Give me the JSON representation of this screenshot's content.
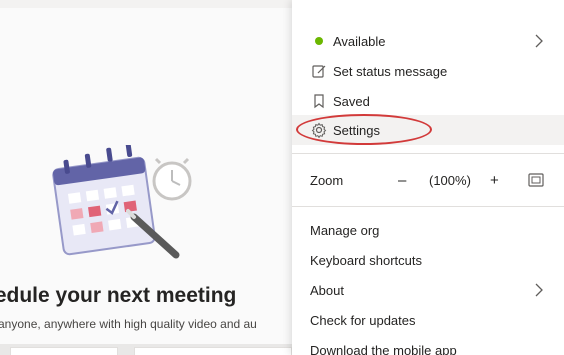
{
  "background": {
    "headline": "hedule your next meeting",
    "subline": "anyone, anywhere with high quality video and au"
  },
  "menu": {
    "status": {
      "label": "Available",
      "icon": "presence-dot-icon",
      "color": "#6bb700"
    },
    "items": [
      {
        "label": "Set status message",
        "icon": "edit-status-icon"
      },
      {
        "label": "Saved",
        "icon": "bookmark-icon"
      },
      {
        "label": "Settings",
        "icon": "gear-icon"
      }
    ],
    "zoom": {
      "label": "Zoom",
      "minus": "–",
      "value": "(100%)",
      "plus": "+",
      "fit_icon": "fullscreen-icon"
    },
    "lower_items": [
      {
        "label": "Manage org"
      },
      {
        "label": "Keyboard shortcuts"
      },
      {
        "label": "About"
      },
      {
        "label": "Check for updates"
      },
      {
        "label": "Download the mobile app"
      }
    ]
  },
  "colors": {
    "annotation": "#d23a3a",
    "accent": "#6264a7"
  }
}
